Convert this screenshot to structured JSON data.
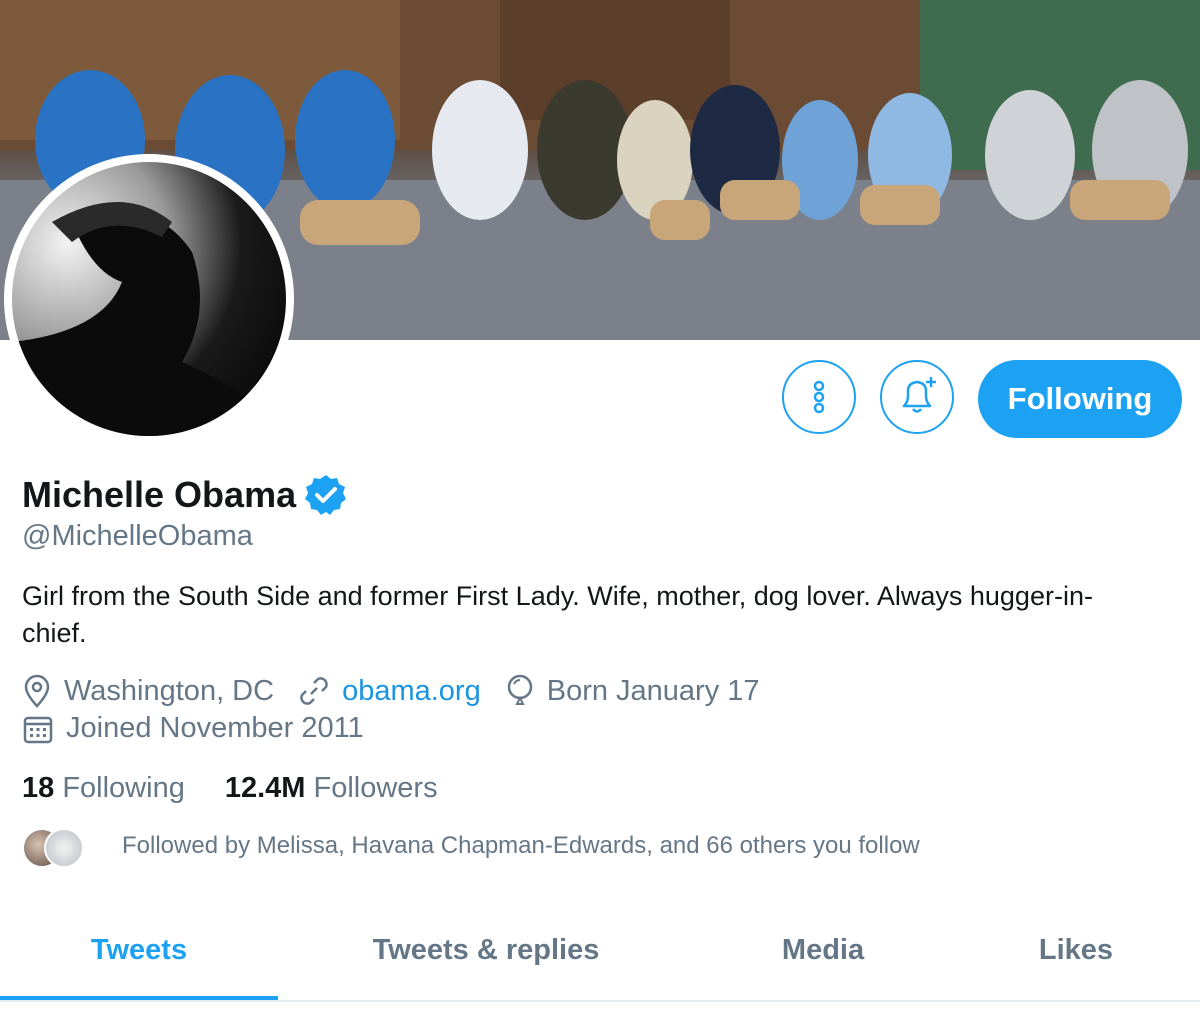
{
  "profile": {
    "name": "Michelle Obama",
    "handle": "@MichelleObama",
    "bio": "Girl from the South Side and former First Lady. Wife, mother, dog lover. Always hugger-in-chief.",
    "location": "Washington, DC",
    "website": "obama.org",
    "birthday": "Born January 17",
    "joined": "Joined November 2011"
  },
  "actions": {
    "more_icon": "more-vertical-icon",
    "notify_icon": "bell-plus-icon",
    "follow_label": "Following"
  },
  "stats": {
    "following_count": "18",
    "following_label": "Following",
    "followers_count": "12.4M",
    "followers_label": "Followers"
  },
  "followed_by": "Followed by Melissa, Havana Chapman-Edwards, and 66 others you follow",
  "tabs": [
    {
      "label": "Tweets",
      "active": true
    },
    {
      "label": "Tweets & replies",
      "active": false
    },
    {
      "label": "Media",
      "active": false
    },
    {
      "label": "Likes",
      "active": false
    }
  ],
  "colors": {
    "accent": "#1da1f2",
    "link": "#1b95e0",
    "secondary_text": "#657786",
    "primary_text": "#14171a"
  }
}
